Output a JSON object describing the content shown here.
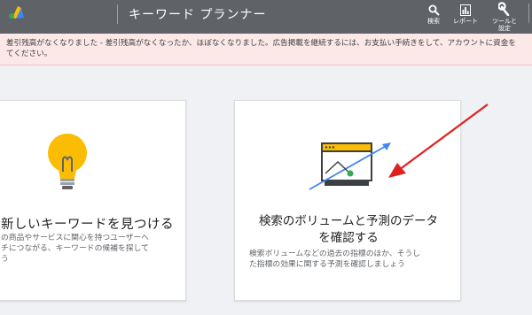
{
  "header": {
    "title": "キーワード プランナー",
    "tools": [
      {
        "label": "検索",
        "icon": "search-icon"
      },
      {
        "label": "レポート",
        "icon": "bar-chart-icon"
      },
      {
        "label_line1": "ツールと",
        "label_line2": "設定",
        "icon": "wrench-icon"
      }
    ]
  },
  "banner": {
    "line1": "差引残高がなくなりました - 差引残高がなくなったか、ほぼなくなりました。広告掲載を継続するには、お支払い手続きをして、アカウントに資金を",
    "line2": "てください。"
  },
  "cards": [
    {
      "title": "新しいキーワードを見つける",
      "desc_lines": [
        "の商品やサービスに関心を持つユーザーへ",
        "チにつながる、キーワードの候補を探して",
        "う"
      ],
      "icon": "lightbulb-icon"
    },
    {
      "title_line1": "検索のボリュームと予測のデータ",
      "title_line2": "を確認する",
      "desc_lines": [
        "検索ボリュームなどの過去の指標のほか、そうし",
        "た指標の効果に関する予測を確認しましょう"
      ],
      "icon": "trend-chart-icon"
    }
  ],
  "colors": {
    "topbar": "#5f6368",
    "banner_bg": "#fce8e6",
    "page_bg": "#eff1f4",
    "bulb_yellow": "#fbbc04",
    "chart_blue": "#4285f4",
    "chart_green": "#34a853",
    "annotation_red": "#e02020"
  }
}
